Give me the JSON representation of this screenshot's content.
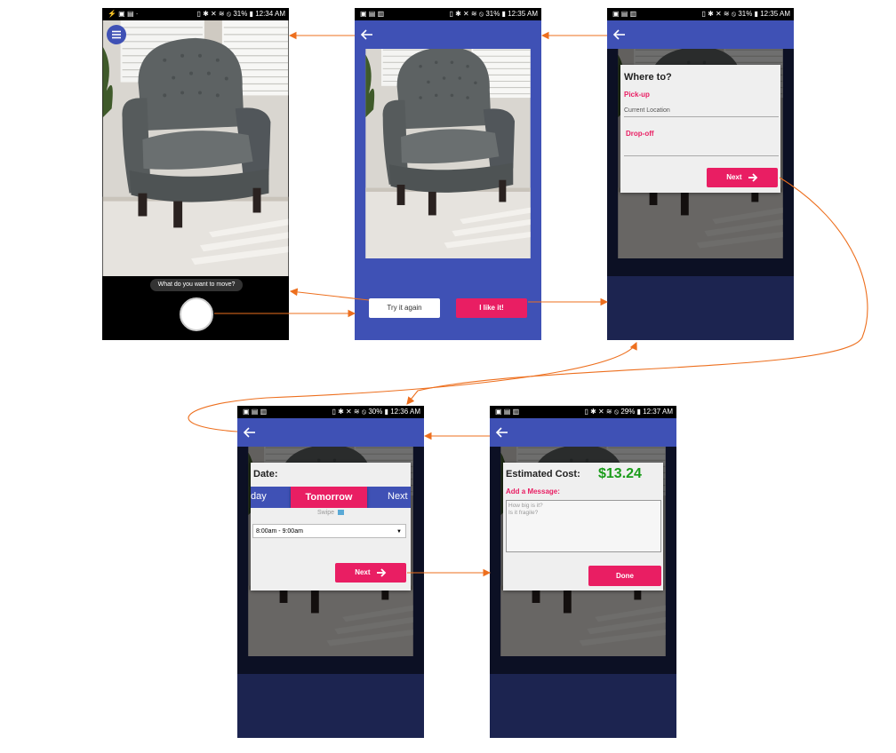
{
  "status_bars": [
    {
      "icons_left": "⚡ ▣ ▤ ·",
      "icons_right": "▯ ✱ ✕ ≋ ⦸",
      "battery": "31%",
      "time": "12:34 AM"
    },
    {
      "icons_left": "▣ ▤ ▥",
      "icons_right": "▯ ✱ ✕ ≋ ⦸",
      "battery": "31%",
      "time": "12:35 AM"
    },
    {
      "icons_left": "▣ ▤ ▥",
      "icons_right": "▯ ✱ ✕ ≋ ⦸",
      "battery": "31%",
      "time": "12:35 AM"
    },
    {
      "icons_left": "▣ ▤ ▥",
      "icons_right": "▯ ✱ ✕ ≋ ⦸",
      "battery": "30%",
      "time": "12:36 AM"
    },
    {
      "icons_left": "▣ ▤ ▥",
      "icons_right": "▯ ✱ ✕ ≋ ⦸",
      "battery": "29%",
      "time": "12:37 AM"
    }
  ],
  "screen1": {
    "prompt": "What do you want to move?",
    "menu_icon": "hamburger-menu-icon",
    "shutter_icon": "camera-shutter-button"
  },
  "screen2": {
    "try_again": "Try it again",
    "like_it": "I like it!"
  },
  "screen3": {
    "title": "Where to?",
    "pickup_label": "Pick-up",
    "pickup_value": "Current Location",
    "dropoff_label": "Drop-off",
    "dropoff_value": "",
    "next": "Next"
  },
  "screen4": {
    "title": "Date:",
    "day_prev": "day",
    "day_selected": "Tomorrow",
    "day_next": "Next",
    "swipe_hint": "Swipe",
    "time_select": "8:00am - 9:00am",
    "next": "Next"
  },
  "screen5": {
    "cost_label": "Estimated Cost:",
    "cost_value": "$13.24",
    "message_label": "Add a Message:",
    "message_placeholder_line1": "How big is it?",
    "message_placeholder_line2": "Is it fragile?",
    "done": "Done"
  },
  "colors": {
    "appbar": "#3f51b5",
    "accent": "#e91e63",
    "flow_arrow": "#ed6f1e",
    "cost_green": "#1a9c1a",
    "dark_panel": "#1c2450"
  }
}
